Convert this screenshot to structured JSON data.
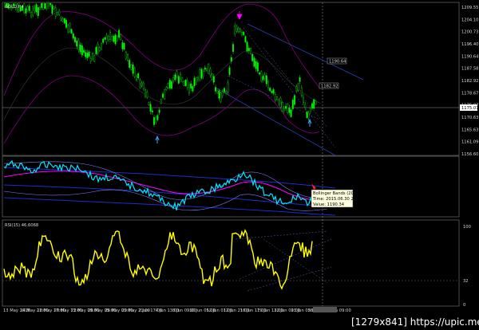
{
  "symbol": "GOLD,H4",
  "price_axis": [
    "1209.55",
    "1204.10",
    "1200.73",
    "1196.40",
    "1190.64",
    "1187.58",
    "1182.92",
    "1178.67",
    "1175.07",
    "1170.63",
    "1165.63",
    "1161.09",
    "1156.60"
  ],
  "price_marks": {
    "label_1190": "1190.64",
    "label_1182": "1182.92",
    "current": "1175.07"
  },
  "middle_panel": {
    "tooltip": [
      "Bollinger Bands (200)",
      "Time: 2015.06.30 21:00",
      "Value: 1190.34"
    ]
  },
  "rsi_panel": {
    "title": "RSI(15) 46.6068",
    "level_high": "100",
    "level_low": "32",
    "level_bottom": "0"
  },
  "time_axis": [
    "13 May 2015",
    "14 May 21:00",
    "18 May 17:00",
    "20 May 13:00",
    "22 May 09:00",
    "26 May 05:00",
    "28 May 01:00",
    "29 May 21:00",
    "2 Jun 17:00",
    "4 Jun 13:00",
    "8 Jun 09:00",
    "10 Jun 05:00",
    "12 Jun 01:00",
    "12 Jun 21:00",
    "16 Jun 17:00",
    "19 Jun 13:00",
    "22 Jun 09:00",
    "23 Jun 05:00",
    "26 Jun 01:00",
    "26 Jun 09:00"
  ],
  "watermark": "[1279x841] https://upic.me/",
  "colors": {
    "bull": "#00d800",
    "bear": "#00d800",
    "bollinger": "#800080",
    "rsi": "#ffff00",
    "channel": "#3050c0",
    "cyan": "#00e5ff",
    "magenta_ma": "#ff00ff"
  }
}
